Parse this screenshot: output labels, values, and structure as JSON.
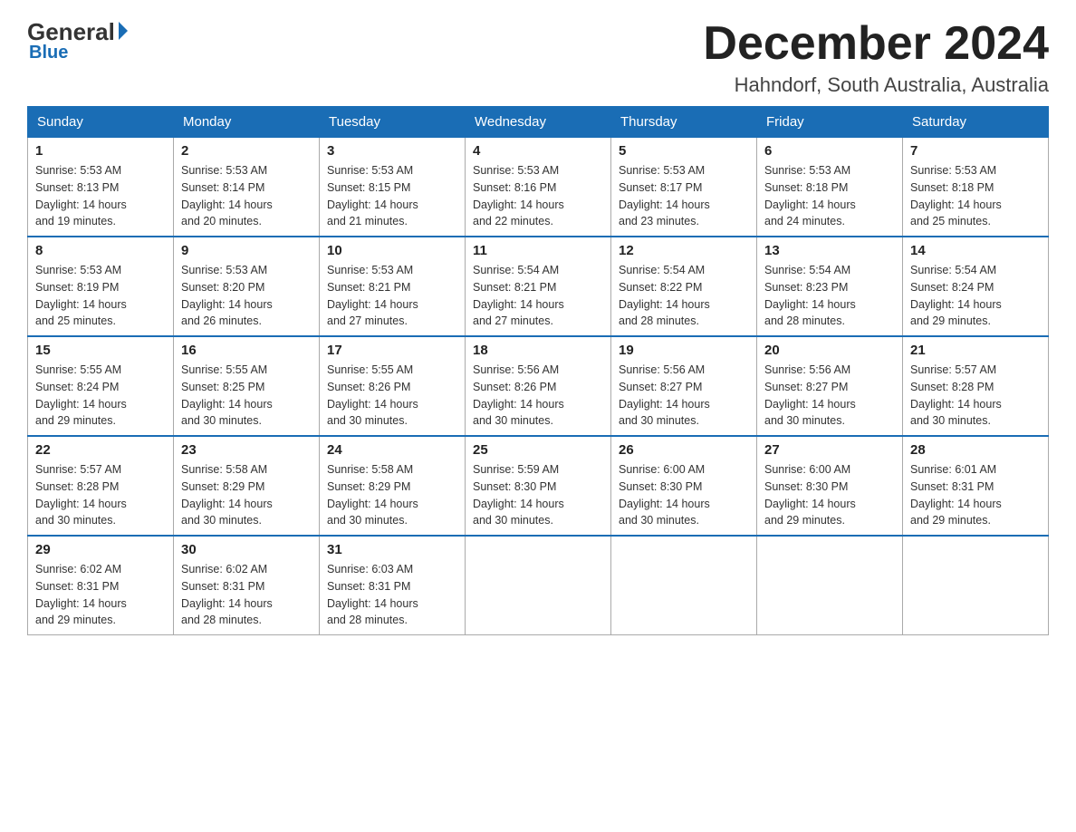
{
  "header": {
    "logo": {
      "general": "General",
      "blue": "Blue"
    },
    "title": "December 2024",
    "location": "Hahndorf, South Australia, Australia"
  },
  "weekdays": [
    "Sunday",
    "Monday",
    "Tuesday",
    "Wednesday",
    "Thursday",
    "Friday",
    "Saturday"
  ],
  "weeks": [
    [
      {
        "day": "1",
        "sunrise": "5:53 AM",
        "sunset": "8:13 PM",
        "daylight": "14 hours and 19 minutes."
      },
      {
        "day": "2",
        "sunrise": "5:53 AM",
        "sunset": "8:14 PM",
        "daylight": "14 hours and 20 minutes."
      },
      {
        "day": "3",
        "sunrise": "5:53 AM",
        "sunset": "8:15 PM",
        "daylight": "14 hours and 21 minutes."
      },
      {
        "day": "4",
        "sunrise": "5:53 AM",
        "sunset": "8:16 PM",
        "daylight": "14 hours and 22 minutes."
      },
      {
        "day": "5",
        "sunrise": "5:53 AM",
        "sunset": "8:17 PM",
        "daylight": "14 hours and 23 minutes."
      },
      {
        "day": "6",
        "sunrise": "5:53 AM",
        "sunset": "8:18 PM",
        "daylight": "14 hours and 24 minutes."
      },
      {
        "day": "7",
        "sunrise": "5:53 AM",
        "sunset": "8:18 PM",
        "daylight": "14 hours and 25 minutes."
      }
    ],
    [
      {
        "day": "8",
        "sunrise": "5:53 AM",
        "sunset": "8:19 PM",
        "daylight": "14 hours and 25 minutes."
      },
      {
        "day": "9",
        "sunrise": "5:53 AM",
        "sunset": "8:20 PM",
        "daylight": "14 hours and 26 minutes."
      },
      {
        "day": "10",
        "sunrise": "5:53 AM",
        "sunset": "8:21 PM",
        "daylight": "14 hours and 27 minutes."
      },
      {
        "day": "11",
        "sunrise": "5:54 AM",
        "sunset": "8:21 PM",
        "daylight": "14 hours and 27 minutes."
      },
      {
        "day": "12",
        "sunrise": "5:54 AM",
        "sunset": "8:22 PM",
        "daylight": "14 hours and 28 minutes."
      },
      {
        "day": "13",
        "sunrise": "5:54 AM",
        "sunset": "8:23 PM",
        "daylight": "14 hours and 28 minutes."
      },
      {
        "day": "14",
        "sunrise": "5:54 AM",
        "sunset": "8:24 PM",
        "daylight": "14 hours and 29 minutes."
      }
    ],
    [
      {
        "day": "15",
        "sunrise": "5:55 AM",
        "sunset": "8:24 PM",
        "daylight": "14 hours and 29 minutes."
      },
      {
        "day": "16",
        "sunrise": "5:55 AM",
        "sunset": "8:25 PM",
        "daylight": "14 hours and 30 minutes."
      },
      {
        "day": "17",
        "sunrise": "5:55 AM",
        "sunset": "8:26 PM",
        "daylight": "14 hours and 30 minutes."
      },
      {
        "day": "18",
        "sunrise": "5:56 AM",
        "sunset": "8:26 PM",
        "daylight": "14 hours and 30 minutes."
      },
      {
        "day": "19",
        "sunrise": "5:56 AM",
        "sunset": "8:27 PM",
        "daylight": "14 hours and 30 minutes."
      },
      {
        "day": "20",
        "sunrise": "5:56 AM",
        "sunset": "8:27 PM",
        "daylight": "14 hours and 30 minutes."
      },
      {
        "day": "21",
        "sunrise": "5:57 AM",
        "sunset": "8:28 PM",
        "daylight": "14 hours and 30 minutes."
      }
    ],
    [
      {
        "day": "22",
        "sunrise": "5:57 AM",
        "sunset": "8:28 PM",
        "daylight": "14 hours and 30 minutes."
      },
      {
        "day": "23",
        "sunrise": "5:58 AM",
        "sunset": "8:29 PM",
        "daylight": "14 hours and 30 minutes."
      },
      {
        "day": "24",
        "sunrise": "5:58 AM",
        "sunset": "8:29 PM",
        "daylight": "14 hours and 30 minutes."
      },
      {
        "day": "25",
        "sunrise": "5:59 AM",
        "sunset": "8:30 PM",
        "daylight": "14 hours and 30 minutes."
      },
      {
        "day": "26",
        "sunrise": "6:00 AM",
        "sunset": "8:30 PM",
        "daylight": "14 hours and 30 minutes."
      },
      {
        "day": "27",
        "sunrise": "6:00 AM",
        "sunset": "8:30 PM",
        "daylight": "14 hours and 29 minutes."
      },
      {
        "day": "28",
        "sunrise": "6:01 AM",
        "sunset": "8:31 PM",
        "daylight": "14 hours and 29 minutes."
      }
    ],
    [
      {
        "day": "29",
        "sunrise": "6:02 AM",
        "sunset": "8:31 PM",
        "daylight": "14 hours and 29 minutes."
      },
      {
        "day": "30",
        "sunrise": "6:02 AM",
        "sunset": "8:31 PM",
        "daylight": "14 hours and 28 minutes."
      },
      {
        "day": "31",
        "sunrise": "6:03 AM",
        "sunset": "8:31 PM",
        "daylight": "14 hours and 28 minutes."
      },
      null,
      null,
      null,
      null
    ]
  ],
  "labels": {
    "sunrise": "Sunrise:",
    "sunset": "Sunset:",
    "daylight": "Daylight:"
  }
}
